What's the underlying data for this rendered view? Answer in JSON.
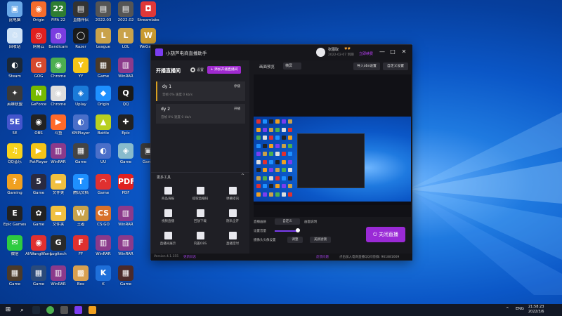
{
  "desktop": {
    "icons": [
      {
        "label": "此电脑",
        "color": "#6aa9e8",
        "g": "▣"
      },
      {
        "label": "Origin",
        "color": "#f56c2d",
        "g": "◉"
      },
      {
        "label": "FIFA 22",
        "color": "#2e7d32",
        "g": "22"
      },
      {
        "label": "直播伴侣",
        "color": "#333",
        "g": "▤"
      },
      {
        "label": "2022.03",
        "color": "#555",
        "g": "▤"
      },
      {
        "label": "2022.02",
        "color": "#555",
        "g": "▤"
      },
      {
        "label": "Streamlabs",
        "color": "#e03838",
        "g": "◘"
      },
      {
        "label": "回收站",
        "color": "#cfe3f7",
        "g": "♲"
      },
      {
        "label": "网易云",
        "color": "#e02020",
        "g": "◎"
      },
      {
        "label": "Bandicam",
        "color": "#7a3de0",
        "g": "◍"
      },
      {
        "label": "Razer",
        "color": "#1a1a1a",
        "g": "◯"
      },
      {
        "label": "League",
        "color": "#c9a24a",
        "g": "L"
      },
      {
        "label": "LOL",
        "color": "#c9a24a",
        "g": "L"
      },
      {
        "label": "WeGame",
        "color": "#c99a30",
        "g": "W"
      },
      {
        "label": "Steam",
        "color": "#1b2838",
        "g": "◐"
      },
      {
        "label": "GOG",
        "color": "#d64a2e",
        "g": "G"
      },
      {
        "label": "Chrome",
        "color": "#4caf50",
        "g": "◉"
      },
      {
        "label": "YY",
        "color": "#f5c518",
        "g": "Y"
      },
      {
        "label": "Game",
        "color": "#4a3a2a",
        "g": "▦"
      },
      {
        "label": "WinRAR",
        "color": "#8b3a8b",
        "g": "▥"
      },
      {
        "label": "",
        "color": "transparent",
        "g": ""
      },
      {
        "label": "英雄联盟",
        "color": "#3a3a3a",
        "g": "✦"
      },
      {
        "label": "GeForce",
        "color": "#76b900",
        "g": "N"
      },
      {
        "label": "Chrome",
        "color": "#dddddd",
        "g": "◉"
      },
      {
        "label": "Uplay",
        "color": "#1a7ad9",
        "g": "◈"
      },
      {
        "label": "Origin",
        "color": "#1e90ff",
        "g": "◆"
      },
      {
        "label": "QQ",
        "color": "#1a1a1a",
        "g": "Q"
      },
      {
        "label": "",
        "color": "transparent",
        "g": ""
      },
      {
        "label": "5E",
        "color": "#4455cc",
        "g": "5E"
      },
      {
        "label": "OBS",
        "color": "#222",
        "g": "◉"
      },
      {
        "label": "斗鱼",
        "color": "#ff6a2a",
        "g": "▶"
      },
      {
        "label": "KMPlayer",
        "color": "#4a6fc9",
        "g": "◐"
      },
      {
        "label": "Battle",
        "color": "#b8d020",
        "g": "▲"
      },
      {
        "label": "Epic",
        "color": "#222",
        "g": "✚"
      },
      {
        "label": "",
        "color": "transparent",
        "g": ""
      },
      {
        "label": "QQ音乐",
        "color": "#f7d21d",
        "g": "♫"
      },
      {
        "label": "PotPlayer",
        "color": "#f5c518",
        "g": "▶"
      },
      {
        "label": "WinRAR",
        "color": "#8b3a8b",
        "g": "▥"
      },
      {
        "label": "Game",
        "color": "#444",
        "g": "▦"
      },
      {
        "label": "UU",
        "color": "#4a6fc9",
        "g": "◐"
      },
      {
        "label": "Game",
        "color": "#8bc",
        "g": "◈"
      },
      {
        "label": "Game",
        "color": "#3a3a3a",
        "g": "▣"
      },
      {
        "label": "Gaming",
        "color": "#f0a020",
        "g": "?"
      },
      {
        "label": "Game",
        "color": "#2a2a40",
        "g": "5"
      },
      {
        "label": "文件夹",
        "color": "#f0c040",
        "g": "▬"
      },
      {
        "label": "腾讯文档",
        "color": "#1e90ff",
        "g": "T"
      },
      {
        "label": "Game",
        "color": "#e03030",
        "g": "◠"
      },
      {
        "label": "PDF",
        "color": "#e02020",
        "g": "PDF"
      },
      {
        "label": "",
        "color": "transparent",
        "g": ""
      },
      {
        "label": "Epic Games",
        "color": "#222",
        "g": "E"
      },
      {
        "label": "Game",
        "color": "#222",
        "g": "✿"
      },
      {
        "label": "文件夹",
        "color": "#f0c040",
        "g": "▬"
      },
      {
        "label": "王者",
        "color": "#c9a24a",
        "g": "W"
      },
      {
        "label": "CS:GO",
        "color": "#d8702a",
        "g": "CS"
      },
      {
        "label": "WinRAR",
        "color": "#8b3a8b",
        "g": "▥"
      },
      {
        "label": "",
        "color": "transparent",
        "g": ""
      },
      {
        "label": "微信",
        "color": "#2ecc40",
        "g": "✉"
      },
      {
        "label": "AliWangWang",
        "color": "#e03030",
        "g": "◉"
      },
      {
        "label": "Logitech",
        "color": "#2a2a2a",
        "g": "G"
      },
      {
        "label": "FF",
        "color": "#e03030",
        "g": "F"
      },
      {
        "label": "WinRAR",
        "color": "#8b3a8b",
        "g": "▥"
      },
      {
        "label": "WinRAR",
        "color": "#8b3a8b",
        "g": "▥"
      },
      {
        "label": "",
        "color": "transparent",
        "g": ""
      },
      {
        "label": "Game",
        "color": "#4a3a2a",
        "g": "▦"
      },
      {
        "label": "Game",
        "color": "#2a4a7a",
        "g": "▦"
      },
      {
        "label": "WinRAR",
        "color": "#8b3a8b",
        "g": "▥"
      },
      {
        "label": "Box",
        "color": "#d8a050",
        "g": "▩"
      },
      {
        "label": "K",
        "color": "#1e6fd9",
        "g": "K"
      },
      {
        "label": "Game",
        "color": "#4a2a2a",
        "g": "▦"
      },
      {
        "label": "",
        "color": "transparent",
        "g": ""
      }
    ]
  },
  "app": {
    "title": "小葫芦电商直播助手",
    "user_name": "张图取",
    "user_badges": "♥♥",
    "user_exp": "2022-02-07 到期",
    "upgrade_label": "立即续费",
    "minimize": "—",
    "maximize": "□",
    "close": "✕",
    "left": {
      "section_title": "开播直播间",
      "settings_label": "设置",
      "add_button": "+ 添加开播直播间",
      "streams": [
        {
          "name": "dy 1",
          "status": "音帧 0%  速度 0 kb/s",
          "action": "停播"
        },
        {
          "name": "dy 2",
          "status": "音帧 0%  速度 0 kb/s",
          "action": "开播"
        }
      ],
      "more_tools_title": "更多工具",
      "more_chevron": "^",
      "tools": [
        {
          "label": "商品海报"
        },
        {
          "label": "提取直播码"
        },
        {
          "label": "弹幕搭讯"
        },
        {
          "label": "视频直播"
        },
        {
          "label": "回放下载"
        },
        {
          "label": "隐私全开"
        },
        {
          "label": "直播间展示"
        },
        {
          "label": "内置OBS"
        },
        {
          "label": "直播定时"
        }
      ]
    },
    "right": {
      "preview_title": "画面预览",
      "preview_select": "横屏",
      "obs_button": "导入obs设置",
      "custom_button": "自定义设置",
      "res_label": "直播画质",
      "res_value": "自定义",
      "res_help": "画面说明",
      "vol_label": "设置音量",
      "camera_label": "摄像头头像设置",
      "camera_btn": "调整",
      "beauty_btn": "美颜滤镜",
      "close_live": "⏻ 关闭直播"
    },
    "footer": {
      "version": "Version 4.1.155",
      "log_label": "更新日志",
      "feedback": "反馈问题",
      "qq": "点击加入电商直播QQ问答群: 961881669"
    }
  },
  "taskbar": {
    "lang": "ENG",
    "time": "21:58:23",
    "date": "2022/3/6"
  }
}
